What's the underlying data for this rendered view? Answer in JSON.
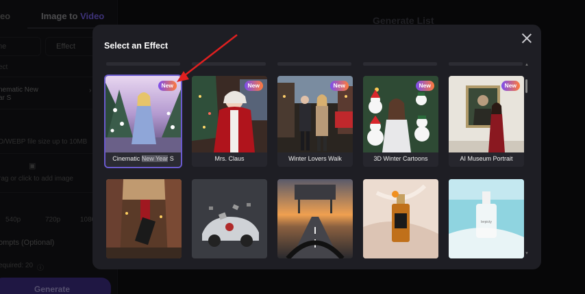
{
  "background": {
    "left_tab_1": "deo",
    "left_tab_2_prefix": "Image to ",
    "left_tab_2_accent": "Video",
    "sub_tab_1": "me",
    "sub_tab_2": "Effect",
    "section_label": "ect",
    "effect_name_line1": "nematic New",
    "effect_name_line2": "ar S",
    "upload_hint": "D/WEBP file size up to 10MB",
    "upload_action": "rag or click to add image",
    "res_1": "540p",
    "res_2": "720p",
    "res_3": "1080",
    "prompts_label": "ompts (Optional)",
    "required_label": "equired: 20",
    "generate_label": "Generate",
    "generate_list_title": "Generate List"
  },
  "modal": {
    "title": "Select an Effect",
    "badge_label": "New",
    "effects": [
      {
        "label_pre": "Cinematic ",
        "label_hl": "New Year",
        "label_post": " S",
        "is_new": true,
        "selected": true
      },
      {
        "label": "Mrs. Claus",
        "is_new": true
      },
      {
        "label": "Winter Lovers Walk",
        "is_new": true
      },
      {
        "label": "3D Winter Cartoons",
        "is_new": true
      },
      {
        "label": "AI Museum Portrait",
        "is_new": true
      }
    ],
    "row2_thumbs": [
      "lipstick-street",
      "car-explosion",
      "road-steering",
      "perfume-bottle",
      "serum-beach"
    ],
    "serum_bottle_text": "lerpicty"
  },
  "colors": {
    "accent": "#6a5acd",
    "badge_start": "#7b4df0",
    "badge_end": "#ff7a3a",
    "arrow": "#e02020"
  }
}
